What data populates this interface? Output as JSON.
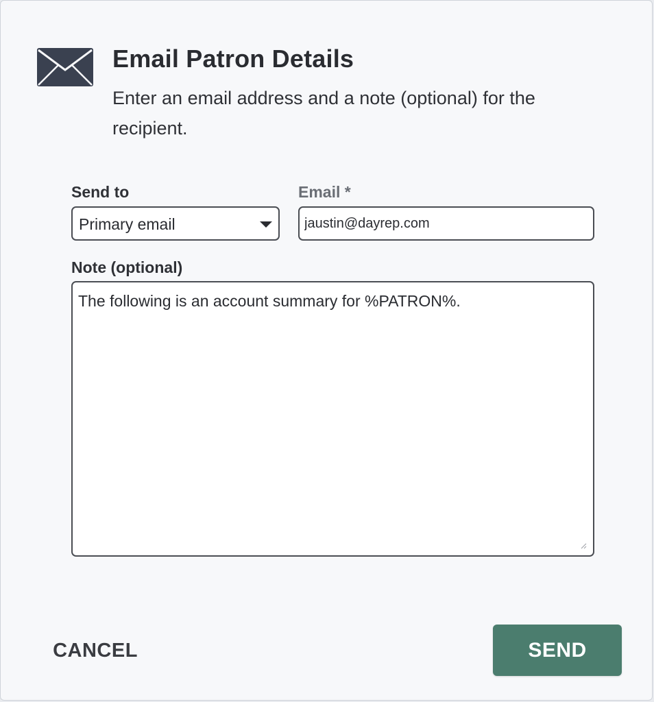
{
  "dialog": {
    "title": "Email Patron Details",
    "subtitle": "Enter an email address and a note (optional) for the recipient."
  },
  "form": {
    "send_to_label": "Send to",
    "send_to_value": "Primary email",
    "email_label": "Email *",
    "email_value": "jaustin@dayrep.com",
    "note_label": "Note (optional)",
    "note_value": "The following is an account summary for %PATRON%."
  },
  "actions": {
    "cancel_label": "CANCEL",
    "send_label": "SEND"
  },
  "colors": {
    "accent": "#4b7d6e",
    "icon": "#3a4150"
  },
  "icons": {
    "header": "envelope-icon",
    "select": "caret-down-icon"
  }
}
